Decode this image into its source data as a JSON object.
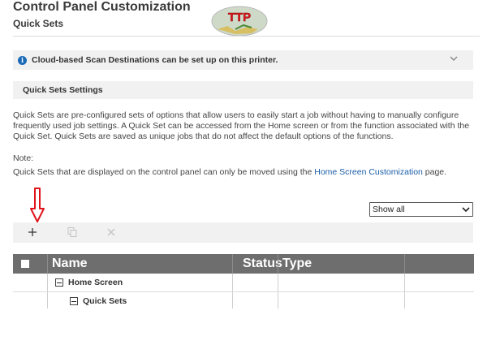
{
  "header": {
    "title": "Control Panel Customization",
    "subtitle": "Quick Sets",
    "logo_text": "TTP"
  },
  "info_bar": {
    "message": "Cloud-based Scan Destinations can be set up on this printer.",
    "icon": "info-icon"
  },
  "section": {
    "title": "Quick Sets Settings",
    "description": "Quick Sets are pre-configured sets of options that allow users to easily start a job without having to manually configure frequently used job settings. A Quick Set can be accessed from the Home screen or from the function associated with the Quick Set. Quick Sets are saved as unique jobs that do not affect the default options of the functions.",
    "note_label": "Note:",
    "note_prefix": "Quick Sets that are displayed on the control panel can only be moved using the ",
    "note_link": "Home Screen Customization",
    "note_suffix": " page."
  },
  "filter": {
    "selected": "Show all"
  },
  "toolbar": {
    "add_icon": "plus-icon",
    "copy_icon": "copy-icon",
    "delete_icon": "close-icon"
  },
  "table": {
    "columns": [
      "Name",
      "Status",
      "Type"
    ],
    "rows": [
      {
        "name": "Home Screen",
        "level": 0,
        "expanded": true
      },
      {
        "name": "Quick Sets",
        "level": 1,
        "expanded": true
      }
    ]
  },
  "colors": {
    "link": "#1a5ea8",
    "info_icon": "#1a6ab8",
    "table_header": "#6e6e6e",
    "annotation_arrow": "#e0141a"
  }
}
